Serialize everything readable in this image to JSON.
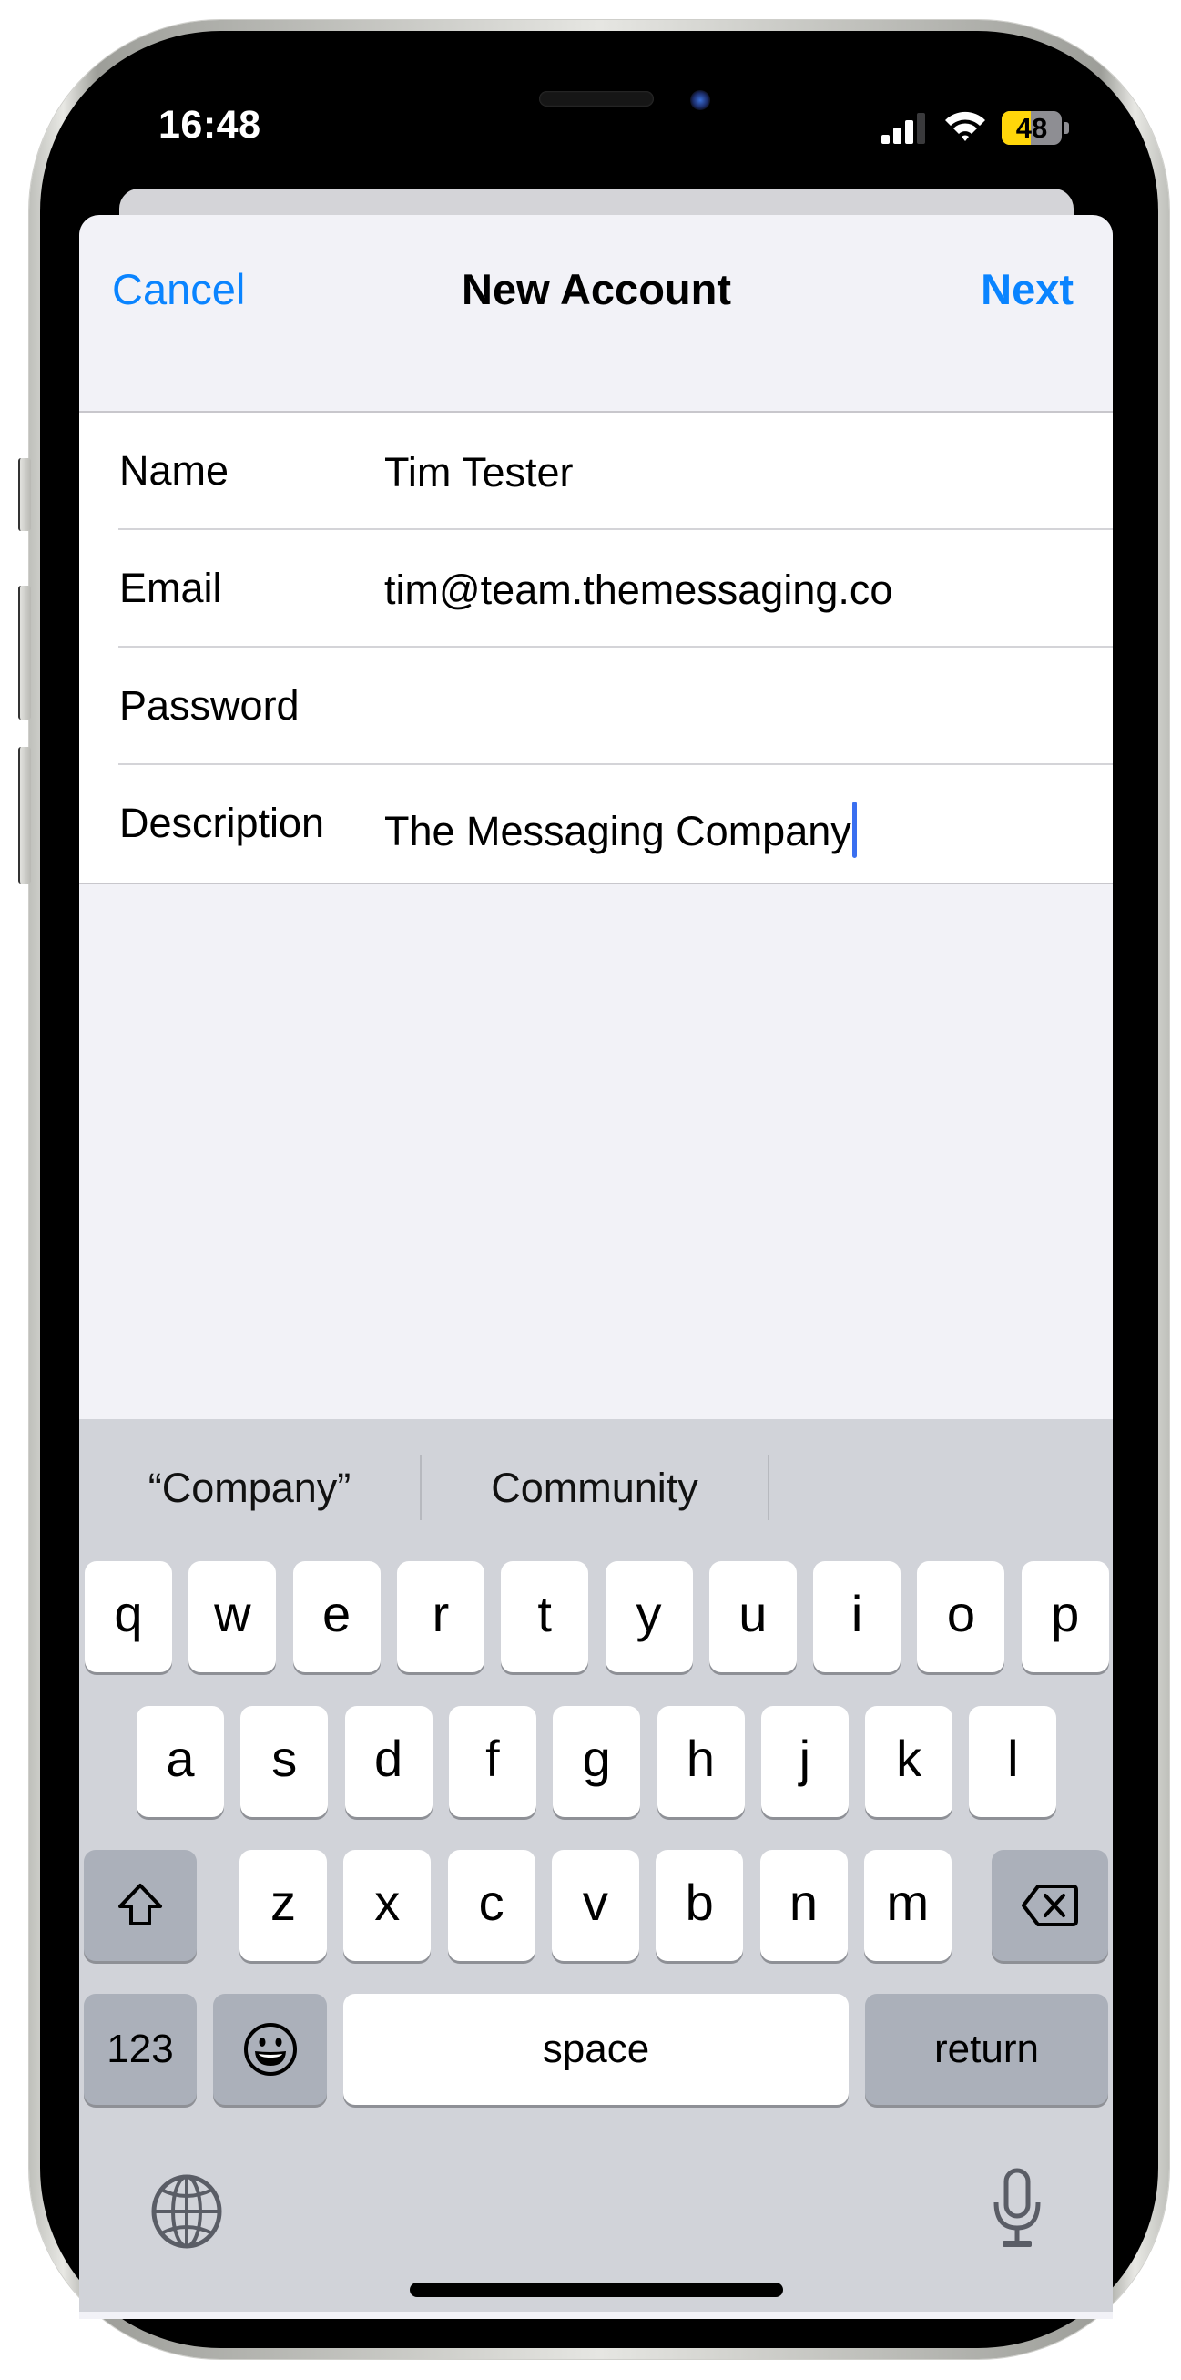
{
  "status_bar": {
    "time": "16:48",
    "signal_bars_filled": 3,
    "signal_bars_total": 4,
    "wifi": "wifi-icon",
    "battery_percent": 48,
    "battery_label": "48",
    "battery_color": "#FFD60A"
  },
  "nav": {
    "cancel_label": "Cancel",
    "title": "New Account",
    "next_label": "Next",
    "accent_color": "#0A84FF"
  },
  "form": {
    "fields": [
      {
        "label": "Name",
        "value": "Tim Tester"
      },
      {
        "label": "Email",
        "value": "tim@team.themessaging.co"
      },
      {
        "label": "Password",
        "value": ""
      },
      {
        "label": "Description",
        "value": "The Messaging Company"
      }
    ],
    "focused_field": "Description"
  },
  "keyboard": {
    "suggestions": [
      "“Company”",
      "Community",
      ""
    ],
    "row1": [
      "q",
      "w",
      "e",
      "r",
      "t",
      "y",
      "u",
      "i",
      "o",
      "p"
    ],
    "row2": [
      "a",
      "s",
      "d",
      "f",
      "g",
      "h",
      "j",
      "k",
      "l"
    ],
    "row3": [
      "z",
      "x",
      "c",
      "v",
      "b",
      "n",
      "m"
    ],
    "shift_icon": "shift-icon",
    "delete_icon": "delete-icon",
    "numbers_label": "123",
    "emoji_icon": "emoji-icon",
    "space_label": "space",
    "return_label": "return",
    "globe_icon": "globe-icon",
    "mic_icon": "microphone-icon"
  }
}
